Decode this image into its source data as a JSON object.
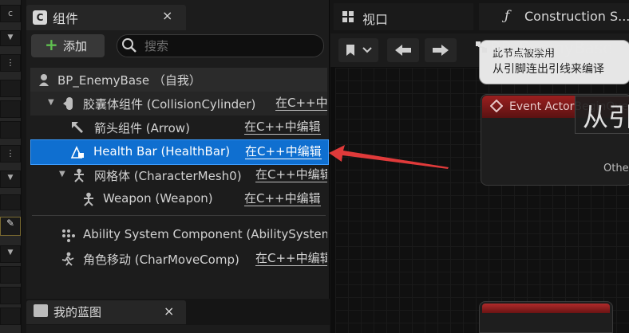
{
  "components_panel": {
    "tab_title": "组件",
    "tab_icon": "C",
    "close_glyph": "×",
    "add_label": "添加",
    "add_plus": "+",
    "search_placeholder": "搜索",
    "rows": [
      {
        "label": "BP_EnemyBase （自我）",
        "edit": ""
      },
      {
        "label": "胶囊体组件 (CollisionCylinder)",
        "edit": "在C++中编辑"
      },
      {
        "label": "箭头组件 (Arrow)",
        "edit": "在C++中编辑"
      },
      {
        "label": "Health Bar (HealthBar)",
        "edit": "在C++中编辑"
      },
      {
        "label": "网格体 (CharacterMesh0)",
        "edit": "在C++中编辑"
      },
      {
        "label": "Weapon (Weapon)",
        "edit": "在C++中编辑"
      },
      {
        "label": "Ability System Component (AbilitySystemComponent)",
        "edit": ""
      },
      {
        "label": "角色移动 (CharMoveComp)",
        "edit": "在C++中编辑"
      }
    ]
  },
  "my_blueprint": {
    "tab_title": "我的蓝图",
    "close_glyph": "×"
  },
  "left_strip": {
    "items": [
      "c",
      "⋮",
      "⋮"
    ]
  },
  "editor_tabs": {
    "viewport": "视口",
    "construction": "Construction S...",
    "construction_icon": "ƒ"
  },
  "graph": {
    "blueprint_name": "BP_EnemyBase",
    "tooltip_line1": "此节点被禁用",
    "tooltip_line2": "从引脚连出引线来编译",
    "event_title": "Event ActorBeginOverlap",
    "comment_text": "从引",
    "other_text": "Othe"
  },
  "colors": {
    "selection": "#0f6fd0",
    "event_header": "#9a1f1f",
    "add_plus": "#5fbf4f",
    "arrow": "#e03a3a"
  },
  "icons": [
    "pawn-icon",
    "capsule-icon",
    "arrow-icon",
    "widget-icon",
    "skeleton-icon",
    "dots-icon",
    "move-icon",
    "search-icon",
    "grid-icon",
    "bookmark-icon",
    "back-arrow-icon",
    "forward-arrow-icon",
    "function-icon",
    "blueprint-book-icon"
  ]
}
